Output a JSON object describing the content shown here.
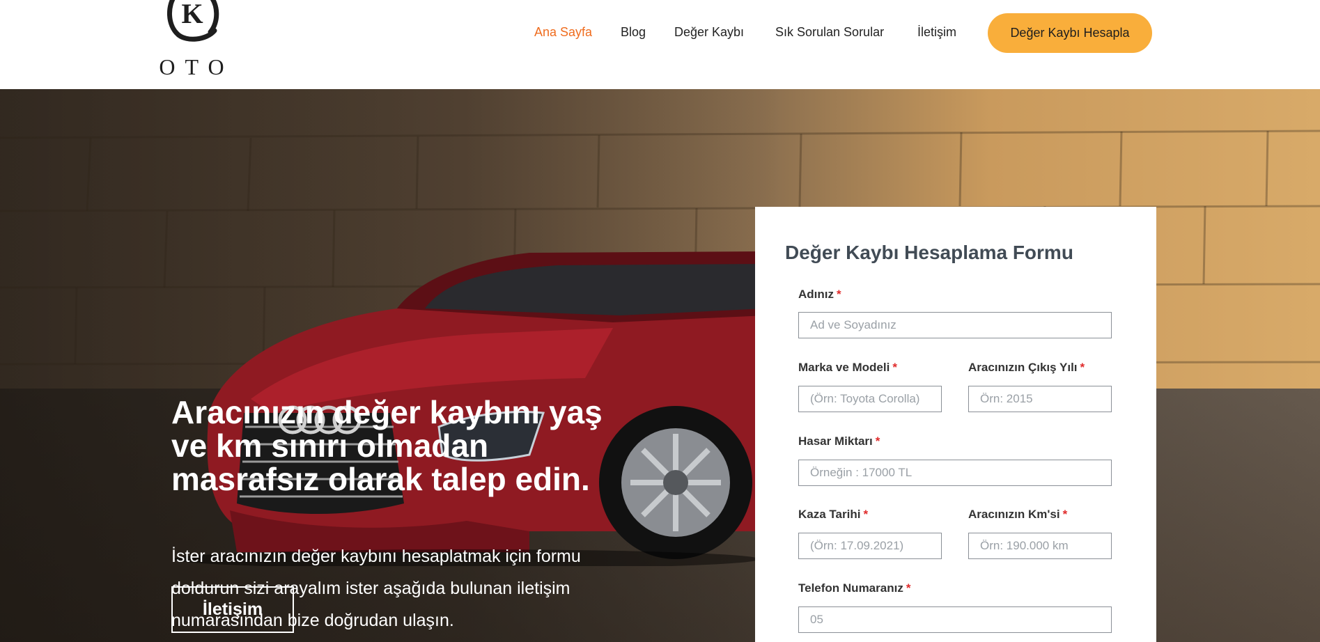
{
  "header": {
    "logo_letter": "K",
    "logo_text": "OTO",
    "nav": [
      {
        "label": "Ana Sayfa",
        "active": true
      },
      {
        "label": "Blog",
        "active": false
      },
      {
        "label": "Değer Kaybı",
        "active": false
      },
      {
        "label": "Sık Sorulan Sorular",
        "active": false
      },
      {
        "label": "İletişim",
        "active": false
      }
    ],
    "cta_label": "Değer Kaybı Hesapla"
  },
  "hero": {
    "title": "Aracınızın değer kaybını yaş ve km sınırı olmadan masrafsız olarak talep edin.",
    "subtitle": "İster aracınızın değer kaybını hesaplatmak için formu doldurun sizi arayalım ister aşağıda bulunan iletişim numarasından bize doğrudan ulaşın.",
    "button_label": "İletişim"
  },
  "form": {
    "title": "Değer Kaybı Hesaplama Formu",
    "required_mark": "*",
    "fields": {
      "name": {
        "label": "Adınız",
        "placeholder": "Ad ve Soyadınız"
      },
      "brand": {
        "label": "Marka ve Modeli",
        "placeholder": "(Örn: Toyota Corolla)"
      },
      "year": {
        "label": "Aracınızın Çıkış Yılı",
        "placeholder": "Örn: 2015"
      },
      "damage": {
        "label": "Hasar Miktarı",
        "placeholder": "Örneğin : 17000 TL"
      },
      "date": {
        "label": "Kaza Tarihi",
        "placeholder": "(Örn: 17.09.2021)"
      },
      "km": {
        "label": "Aracınızın Km'si",
        "placeholder": "Örn: 190.000 km"
      },
      "phone": {
        "label": "Telefon Numaranız",
        "placeholder": "05"
      }
    }
  },
  "colors": {
    "accent_orange": "#ef6c1e",
    "cta_yellow": "#f9ae3b",
    "form_title": "#414b55",
    "required_red": "#e02b2b"
  }
}
